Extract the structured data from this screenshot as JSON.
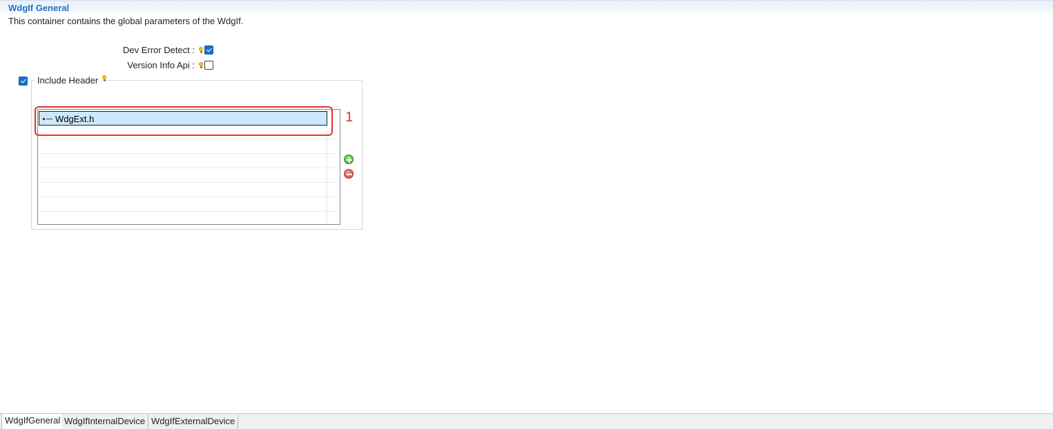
{
  "section": {
    "title": "WdgIf General",
    "description": "This container contains the global parameters of the WdgIf."
  },
  "fields": {
    "dev_error_detect": {
      "label": "Dev Error Detect :",
      "checked": true
    },
    "version_info_api": {
      "label": "Version Info Api :",
      "checked": false
    }
  },
  "include_header": {
    "label": "Include Header",
    "checked": true,
    "rows": [
      "WdgExt.h"
    ],
    "annotation": "1"
  },
  "icons": {
    "hint": "lightbulb-icon",
    "add": "add-icon",
    "remove": "remove-icon",
    "row": "tree-leaf-icon"
  },
  "tabs": [
    {
      "label": "WdgIfGeneral",
      "active": true
    },
    {
      "label": "WdgIfInternalDevice",
      "active": false
    },
    {
      "label": "WdgIfExternalDevice",
      "active": false
    }
  ],
  "colors": {
    "title": "#1f6fc4",
    "checkbox": "#1a6fd0",
    "selection": "#cce8ff",
    "annotation": "#e0332b",
    "add": "#3aa62a",
    "remove": "#d43a3a"
  }
}
